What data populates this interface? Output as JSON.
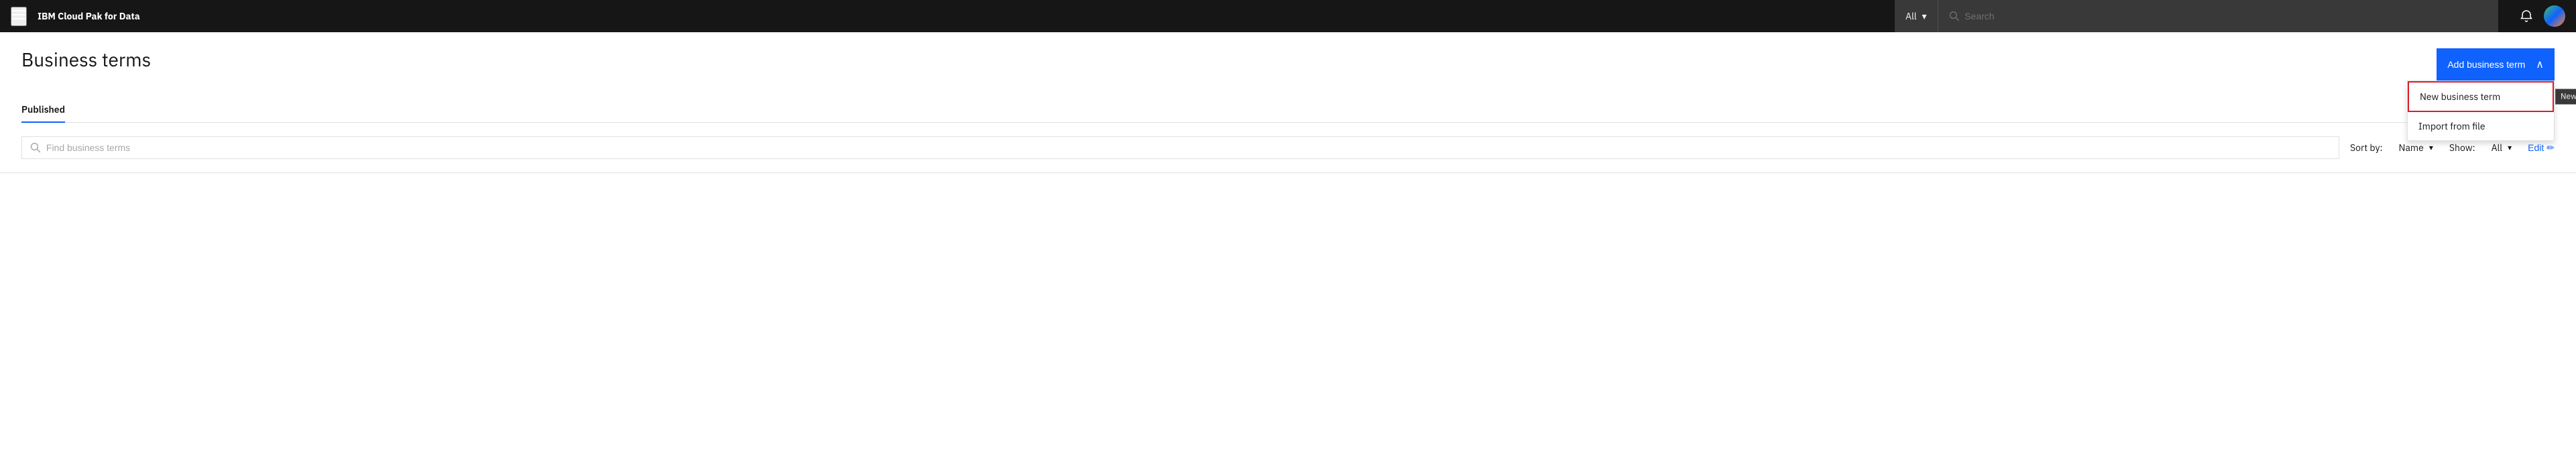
{
  "navbar": {
    "menu_icon": "☰",
    "brand_text": "IBM ",
    "brand_bold": "Cloud Pak for Data",
    "search_filter": "All",
    "search_placeholder": "Search",
    "notification_icon": "🔔"
  },
  "page": {
    "title": "Business terms",
    "add_button_label": "Add business term",
    "chevron_icon": "∧"
  },
  "dropdown": {
    "items": [
      {
        "label": "New business term",
        "highlighted": true
      },
      {
        "label": "Import from file",
        "highlighted": false
      }
    ],
    "tooltip": "New business term"
  },
  "tabs": [
    {
      "label": "Published",
      "active": true
    }
  ],
  "filter_bar": {
    "find_placeholder": "Find business terms",
    "sort_label": "Sort by:",
    "sort_value": "Name",
    "show_label": "Show:",
    "show_value": "All",
    "edit_label": "Edit"
  }
}
